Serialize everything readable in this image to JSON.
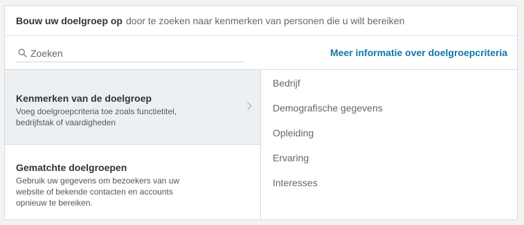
{
  "header": {
    "title_bold": "Bouw uw doelgroep op",
    "title_rest": "door te zoeken naar kenmerken van personen die u wilt bereiken"
  },
  "search": {
    "placeholder": "Zoeken",
    "icon": "search-icon"
  },
  "more_info_link": "Meer informatie over doelgroepcriteria",
  "options": [
    {
      "title": "Kenmerken van de doelgroep",
      "description": "Voeg doelgroepcriteria toe zoals functietitel, bedrijfstak of vaardigheden",
      "selected": true,
      "icon": "chevron-right-icon"
    },
    {
      "title": "Gematchte doelgroepen",
      "description": "Gebruik uw gegevens om bezoekers van uw website of bekende contacten en accounts opnieuw te bereiken.",
      "selected": false
    }
  ],
  "categories": [
    "Bedrijf",
    "Demografische gegevens",
    "Opleiding",
    "Ervaring",
    "Interesses"
  ],
  "colors": {
    "link": "#0e76a8",
    "selected_bg": "#edf0f3",
    "border": "#d6d9dc"
  }
}
